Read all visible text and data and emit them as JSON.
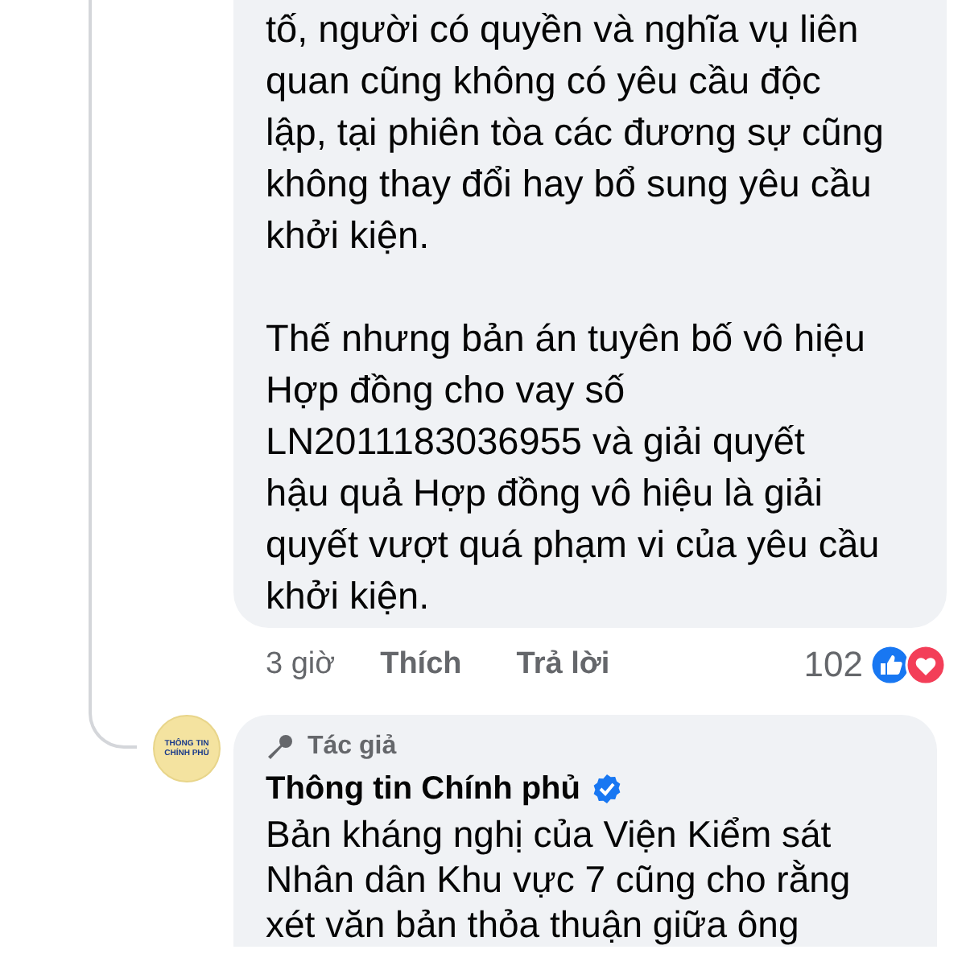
{
  "comment": {
    "paragraphs": [
      [
        "tố, người có quyền và nghĩa vụ liên",
        "quan cũng không có yêu cầu độc",
        "lập, tại phiên tòa các đương sự cũng",
        "không thay đổi hay bổ sung yêu cầu",
        "khởi kiện."
      ],
      [
        "Thế nhưng bản án tuyên bố vô hiệu",
        "Hợp đồng cho vay số",
        "LN2011183036955 và giải quyết",
        "hậu quả Hợp đồng vô hiệu là giải",
        "quyết vượt quá phạm vi của yêu cầu",
        "khởi kiện."
      ]
    ],
    "time": "3 giờ",
    "actions": [
      "Thích",
      "Trả lời"
    ],
    "reaction_count": "102"
  },
  "reply": {
    "avatar_text": "THÔNG TIN CHÍNH PHỦ",
    "badge": "Tác giả",
    "author": "Thông tin Chính phủ",
    "verified": true,
    "paragraphs": [
      [
        "Bản kháng nghị của Viện Kiểm sát",
        "Nhân dân Khu vực 7 cũng cho rằng",
        "xét văn bản thỏa thuận giữa ông"
      ]
    ]
  }
}
